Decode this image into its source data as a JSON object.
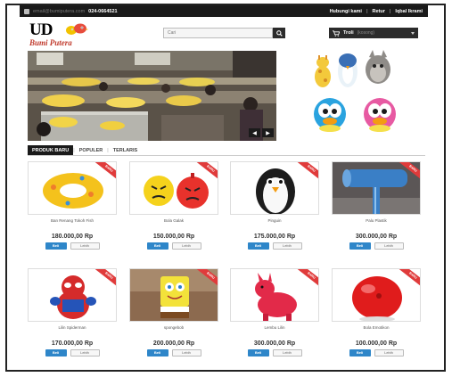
{
  "topbar": {
    "email": "email@bumiputera.com",
    "phone": "024-0664521",
    "links": [
      "Hubungi kami",
      "Retur",
      "Iqbal Ikrami"
    ]
  },
  "logo": {
    "name": "UD",
    "tagline": "Bumi Putera"
  },
  "search": {
    "placeholder": "Cari"
  },
  "cart": {
    "label": "Troli",
    "count": "(kosong)"
  },
  "tabs": [
    {
      "label": "PRODUK BARU",
      "active": true
    },
    {
      "label": "POPULER",
      "active": false
    },
    {
      "label": "TERLARIS",
      "active": false
    }
  ],
  "labels": {
    "badge": "BARU",
    "buy": "Beli",
    "detail": "Lebih"
  },
  "products": [
    {
      "name": "Ban Renang Tokoh Fish",
      "price": "180.000,00 Rp",
      "image": "swim-ring"
    },
    {
      "name": "Bola Galak",
      "price": "150.000,00 Rp",
      "image": "angry-balls"
    },
    {
      "name": "Pinguin",
      "price": "175.000,00 Rp",
      "image": "penguin"
    },
    {
      "name": "Palu Plastik",
      "price": "300.000,00 Rp",
      "image": "hammer"
    },
    {
      "name": "Lilin Spiderman",
      "price": "170.000,00 Rp",
      "image": "spiderman"
    },
    {
      "name": "spongebob",
      "price": "200.000,00 Rp",
      "image": "spongebob"
    },
    {
      "name": "Lembu Lilin",
      "price": "300.000,00 Rp",
      "image": "red-horse"
    },
    {
      "name": "Bola Emotikon",
      "price": "100.000,00 Rp",
      "image": "red-ball"
    }
  ],
  "colors": {
    "accent": "#2e86c9",
    "badge": "#e03b3b",
    "dark": "#1a1a1a"
  }
}
